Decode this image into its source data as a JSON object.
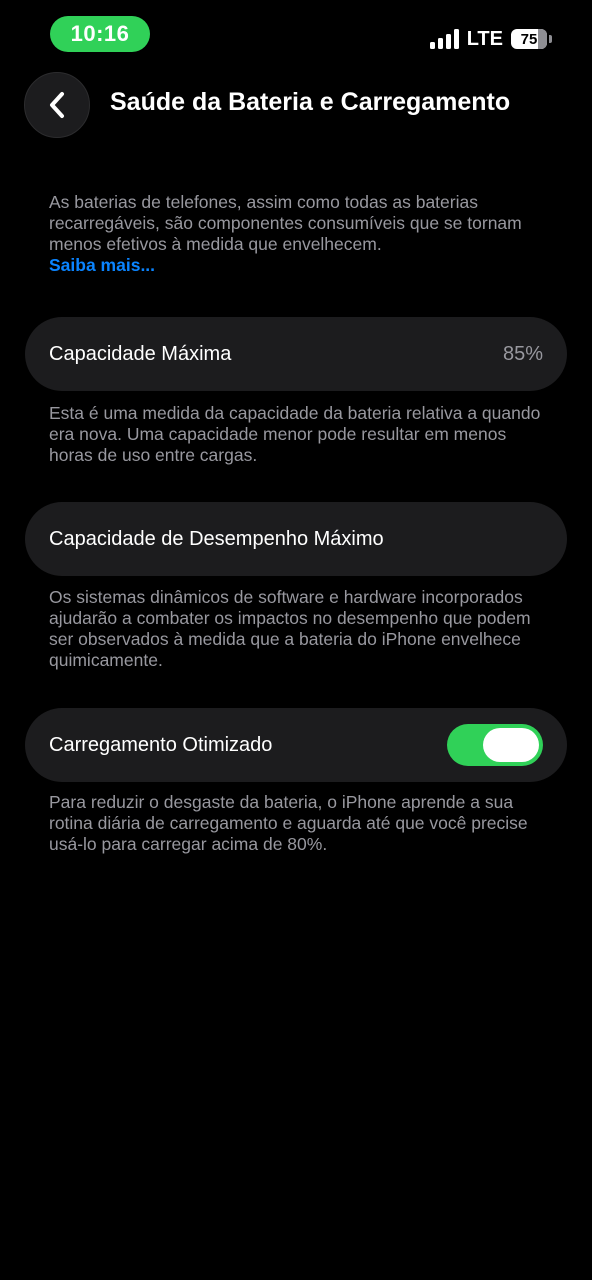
{
  "status_bar": {
    "time": "10:16",
    "network": "LTE",
    "battery_level": "75",
    "icons": [
      "signal-icon",
      "battery-icon"
    ]
  },
  "header": {
    "back_icon": "chevron-left-icon",
    "title": "Saúde da Bateria e Carregamento"
  },
  "intro": {
    "text": "As baterias de telefones, assim como todas as baterias recarregáveis, são componentes consumíveis que se tornam menos efetivos à medida que envelhecem.",
    "link": "Saiba mais..."
  },
  "max_capacity": {
    "label": "Capacidade Máxima",
    "value": "85%",
    "description": "Esta é uma medida da capacidade da bateria relativa a quando era nova. Uma capacidade menor pode resultar em menos horas de uso entre cargas."
  },
  "peak_performance": {
    "label": "Capacidade de Desempenho Máximo",
    "description": "Os sistemas dinâmicos de software e hardware incorporados ajudarão a combater os impactos no desempenho que podem ser observados à medida que a bateria do iPhone envelhece quimicamente."
  },
  "optimized_charging": {
    "label": "Carregamento Otimizado",
    "enabled": true,
    "description": "Para reduzir o desgaste da bateria, o iPhone aprende a sua rotina diária de carregamento e aguarda até que você precise usá-lo para carregar acima de 80%."
  },
  "colors": {
    "accent_green": "#30d158",
    "link_blue": "#0a84ff",
    "row_background": "#1c1c1e",
    "secondary_text": "#98989f"
  }
}
